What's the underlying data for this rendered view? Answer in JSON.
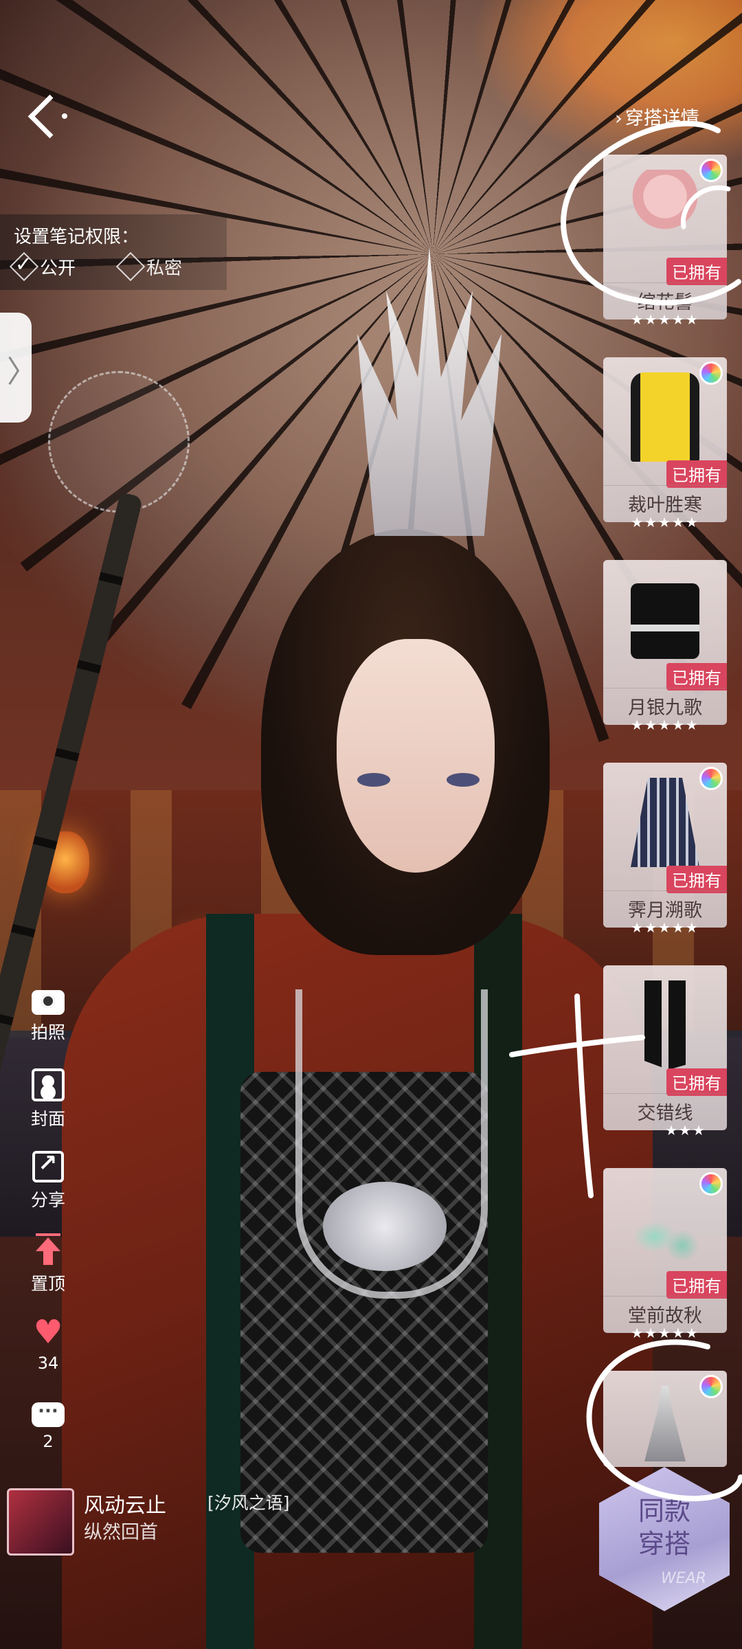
{
  "nav": {
    "back_label": "返回"
  },
  "permission": {
    "title": "设置笔记权限：",
    "public_label": "公开",
    "private_label": "私密",
    "selected": "公开"
  },
  "side_tab": {
    "glyph": "〉"
  },
  "actions": {
    "photo": "拍照",
    "cover": "封面",
    "share": "分享",
    "pin": "置顶",
    "likes": "34",
    "comments": "2"
  },
  "user": {
    "name": "风动云止",
    "subtitle": "纵然回首",
    "game_tag": "[汐风之语]"
  },
  "outfit": {
    "details_label": "穿搭详情",
    "owned_label": "已拥有",
    "items": [
      {
        "name": "绾花髻",
        "owned": true,
        "stars": "★★★★★"
      },
      {
        "name": "裁叶胜寒",
        "owned": true,
        "stars": "★★★★★"
      },
      {
        "name": "月银九歌",
        "owned": true,
        "stars": "★★★★★"
      },
      {
        "name": "霁月溯歌",
        "owned": true,
        "stars": "★★★★★"
      },
      {
        "name": "交错线",
        "owned": true,
        "stars": "★★★"
      },
      {
        "name": "堂前故秋",
        "owned": true,
        "stars": "★★★★★"
      },
      {
        "name": "",
        "owned": false,
        "stars": ""
      }
    ]
  },
  "same_outfit": {
    "line1": "同款",
    "line2": "穿搭",
    "watermark": "WEAR"
  },
  "colors": {
    "owned_badge": "#d9455e",
    "like_heart": "#ff5b6e",
    "annotation": "#ffffff"
  },
  "icons": [
    "back-chevron-icon",
    "check-icon",
    "diamond-icon",
    "camera-icon",
    "cover-icon",
    "share-icon",
    "pin-top-icon",
    "heart-icon",
    "comment-icon",
    "color-palette-icon"
  ]
}
